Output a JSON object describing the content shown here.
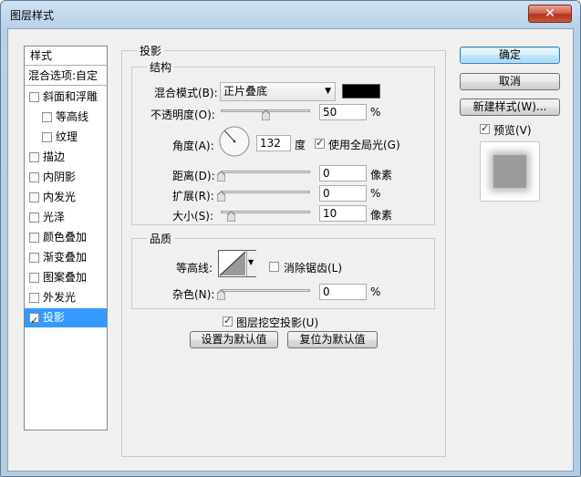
{
  "window": {
    "title": "图层样式"
  },
  "sidebar": {
    "header": "样式",
    "blending": "混合选项:自定",
    "items": [
      {
        "label": "斜面和浮雕",
        "checked": false
      },
      {
        "label": "等高线",
        "checked": false
      },
      {
        "label": "纹理",
        "checked": false
      },
      {
        "label": "描边",
        "checked": false
      },
      {
        "label": "内阴影",
        "checked": false
      },
      {
        "label": "内发光",
        "checked": false
      },
      {
        "label": "光泽",
        "checked": false
      },
      {
        "label": "颜色叠加",
        "checked": false
      },
      {
        "label": "渐变叠加",
        "checked": false
      },
      {
        "label": "图案叠加",
        "checked": false
      },
      {
        "label": "外发光",
        "checked": false
      },
      {
        "label": "投影",
        "checked": true
      }
    ]
  },
  "panel": {
    "title": "投影",
    "structure": {
      "title": "结构",
      "blend_mode_label": "混合模式(B):",
      "blend_mode_value": "正片叠底",
      "shadow_color": "#000000",
      "opacity_label": "不透明度(O):",
      "opacity_value": "50",
      "opacity_unit": "%",
      "angle_label": "角度(A):",
      "angle_value": "132",
      "angle_unit": "度",
      "global_light_label": "使用全局光(G)",
      "distance_label": "距离(D):",
      "distance_value": "0",
      "distance_unit": "像素",
      "spread_label": "扩展(R):",
      "spread_value": "0",
      "spread_unit": "%",
      "size_label": "大小(S):",
      "size_value": "10",
      "size_unit": "像素"
    },
    "quality": {
      "title": "品质",
      "contour_label": "等高线:",
      "antialias_label": "消除锯齿(L)",
      "noise_label": "杂色(N):",
      "noise_value": "0",
      "noise_unit": "%"
    },
    "knockout_label": "图层挖空投影(U)",
    "make_default": "设置为默认值",
    "reset_default": "复位为默认值"
  },
  "buttons": {
    "ok": "确定",
    "cancel": "取消",
    "new_style": "新建样式(W)...",
    "preview": "预览(V)"
  }
}
